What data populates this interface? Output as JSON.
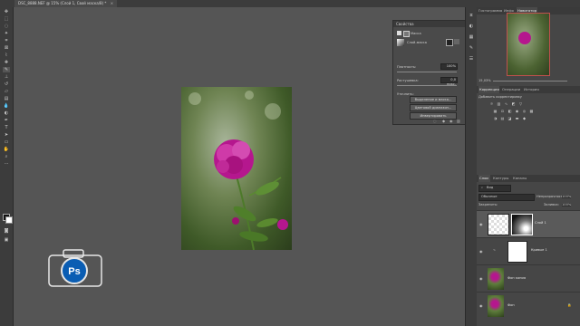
{
  "document": {
    "tab_label": "DSC_8888.NEF @ 15% (Слой 1, Свой маска/8) *",
    "close": "×"
  },
  "tools": [
    "move",
    "marquee",
    "lasso",
    "magic-wand",
    "crop",
    "eyedropper",
    "healing",
    "brush",
    "stamp",
    "history-brush",
    "eraser",
    "gradient",
    "blur",
    "dodge",
    "pen",
    "type",
    "path-select",
    "shape",
    "hand",
    "zoom",
    "more"
  ],
  "properties": {
    "title": "Свойства",
    "mask_label": "Маска",
    "layer_mask_label": "Слой-маска",
    "density_label": "Плотность:",
    "density_value": "100%",
    "feather_label": "Растушевка:",
    "feather_value": "0,0 пикс.",
    "refine_label": "Уточнить:",
    "select_and_mask_button": "Выделение и маска...",
    "color_range_button": "Цветовой диапазон...",
    "invert_button": "Инвертировать"
  },
  "navigator": {
    "tabs": [
      "Гистограмма",
      "Инфо",
      "Навигатор"
    ],
    "active_tab": "Навигатор",
    "zoom": "15,03%"
  },
  "adjustments": {
    "tabs": [
      "Коррекция",
      "Операции",
      "История"
    ],
    "active_tab": "Коррекция",
    "heading": "Добавить корректировку"
  },
  "layers": {
    "tabs": [
      "Слои",
      "Контуры",
      "Каналы"
    ],
    "active_tab": "Слои",
    "filter_label": "Вид",
    "blend_mode": "Обычные",
    "opacity_label": "Непрозрачность:",
    "opacity_value": "100%",
    "lock_label": "Закрепить:",
    "fill_label": "Заливка:",
    "fill_value": "100%",
    "items": [
      {
        "name": "Слой 1"
      },
      {
        "name": "Кривые 1"
      },
      {
        "name": "Фон копия"
      },
      {
        "name": "Фон"
      }
    ]
  },
  "colors": {
    "accent": "#0a5db3",
    "nav_frame": "#c0504d",
    "flower": "#b5178e"
  }
}
